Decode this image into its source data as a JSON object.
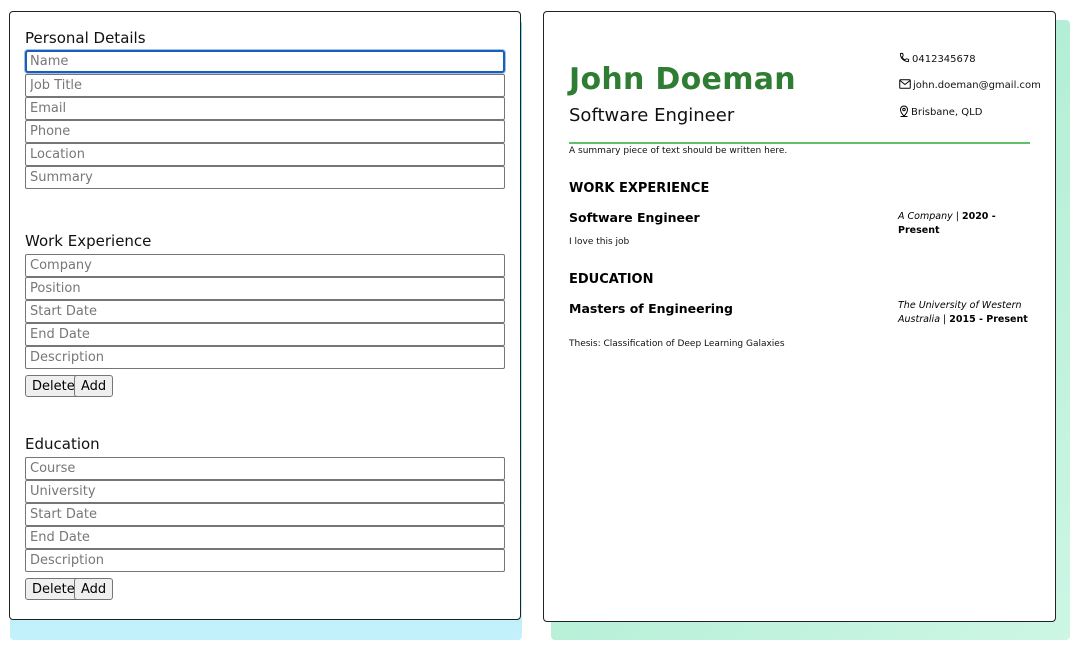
{
  "editor": {
    "personal": {
      "heading": "Personal Details",
      "fields": [
        {
          "placeholder": "Name",
          "value": ""
        },
        {
          "placeholder": "Job Title",
          "value": ""
        },
        {
          "placeholder": "Email",
          "value": ""
        },
        {
          "placeholder": "Phone",
          "value": ""
        },
        {
          "placeholder": "Location",
          "value": ""
        },
        {
          "placeholder": "Summary",
          "value": ""
        }
      ]
    },
    "work": {
      "heading": "Work Experience",
      "fields": [
        {
          "placeholder": "Company"
        },
        {
          "placeholder": "Position"
        },
        {
          "placeholder": "Start Date"
        },
        {
          "placeholder": "End Date"
        },
        {
          "placeholder": "Description"
        }
      ],
      "delete_label": "Delete",
      "add_label": "Add"
    },
    "education": {
      "heading": "Education",
      "fields": [
        {
          "placeholder": "Course"
        },
        {
          "placeholder": "University"
        },
        {
          "placeholder": "Start Date"
        },
        {
          "placeholder": "End Date"
        },
        {
          "placeholder": "Description"
        }
      ],
      "delete_label": "Delete",
      "add_label": "Add"
    }
  },
  "preview": {
    "name": "John Doeman",
    "job_title": "Software Engineer",
    "contact": {
      "phone": "0412345678",
      "email": "john.doeman@gmail.com",
      "location": "Brisbane, QLD",
      "phone_icon": "phone-icon",
      "email_icon": "mail-icon",
      "location_icon": "map-pin-icon"
    },
    "summary": "A summary piece of text should be written here.",
    "work_heading": "WORK EXPERIENCE",
    "work": {
      "position": "Software Engineer",
      "company": "A Company",
      "separator": " | ",
      "dates": "2020 - Present",
      "description": "I love this job"
    },
    "education_heading": "EDUCATION",
    "education": {
      "course": "Masters of Engineering",
      "university": "The University of Western Australia",
      "separator": " | ",
      "dates": "2015 - Present",
      "description": "Thesis: Classification of Deep Learning Galaxies"
    }
  },
  "colors": {
    "name_green": "#2e7d32",
    "rule_green": "#5fbf6b",
    "focus_blue": "#1a5fb4",
    "left_shadow": "#59d7f5",
    "right_shadow": "#9fe8c9"
  }
}
